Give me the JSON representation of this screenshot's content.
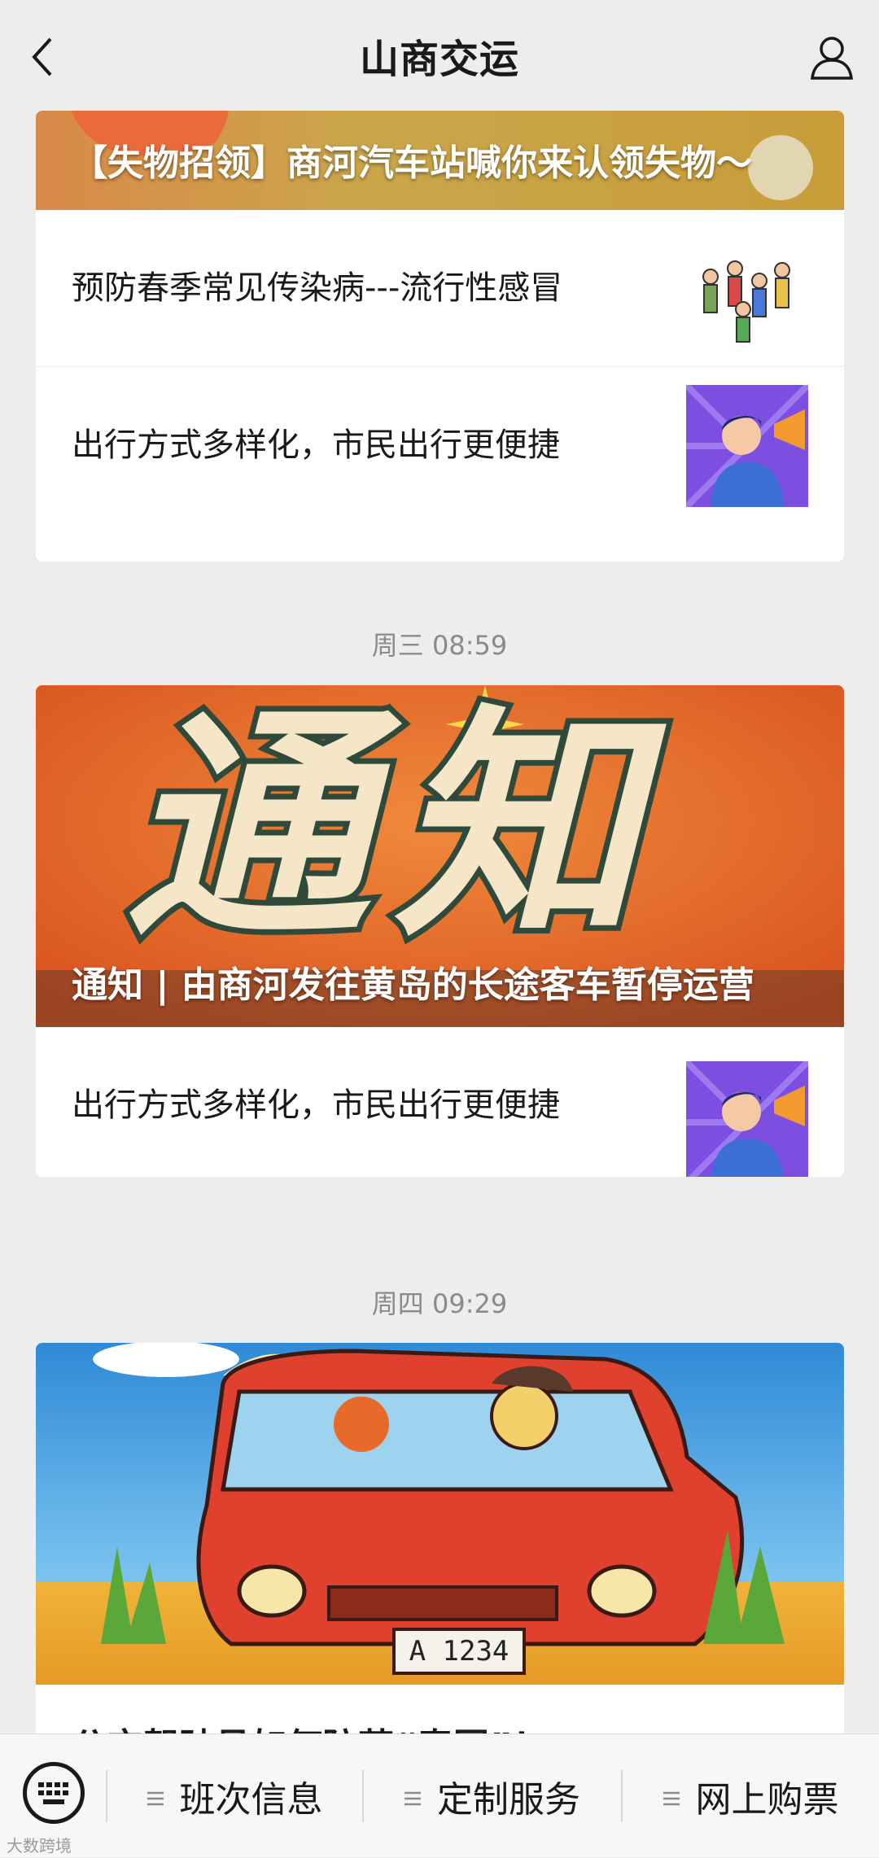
{
  "header": {
    "title": "山商交运"
  },
  "block1": {
    "cover_caption": "【失物招领】商河汽车站喊你来认领失物～",
    "items": [
      {
        "title": "预防春季常见传染病---流行性感冒",
        "thumb": "people-exercise-image"
      },
      {
        "title": "出行方式多样化，市民出行更便捷",
        "thumb": "megaphone-man-image"
      }
    ]
  },
  "time2": "周三 08:59",
  "block2": {
    "cover_caption": "通知 | 由商河发往黄岛的长途客车暂停运营",
    "cover_text": "通知",
    "items": [
      {
        "title": "出行方式多样化，市民出行更便捷",
        "thumb": "megaphone-man-image"
      }
    ]
  },
  "time3": "周四 09:29",
  "block3": {
    "cover_caption": "公交驾驶员如何防范“春困”！",
    "plate": "A 1234"
  },
  "bottom": {
    "menus": [
      "班次信息",
      "定制服务",
      "网上购票"
    ]
  },
  "watermark": "大数跨境",
  "colors": {
    "background": "#ededed",
    "card": "#ffffff",
    "orange": "#e8692a"
  }
}
